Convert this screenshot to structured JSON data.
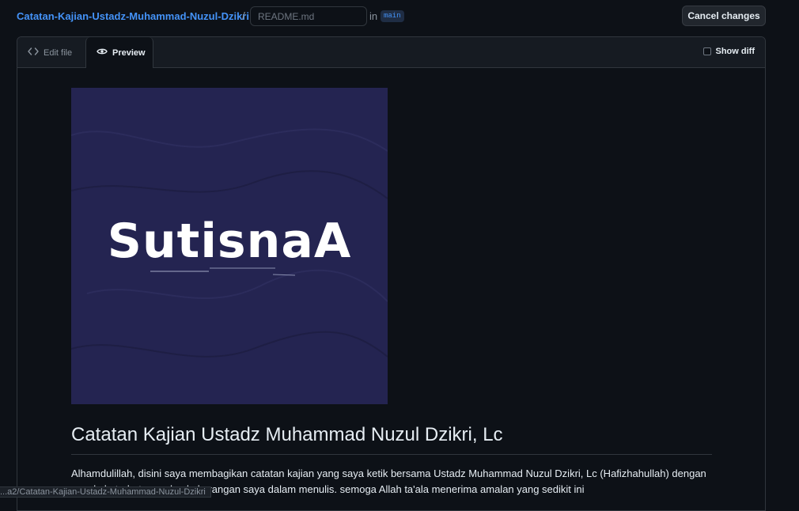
{
  "header": {
    "repo_name": "Catatan-Kajian-Ustadz-Muhammad-Nuzul-Dzikri",
    "separator": "/",
    "filename_placeholder": "README.md",
    "in_label": "in",
    "branch": "main",
    "cancel_label": "Cancel changes"
  },
  "tabs": {
    "edit_label": "Edit file",
    "preview_label": "Preview",
    "show_diff_label": "Show diff"
  },
  "preview": {
    "banner_title": "SutisnaA",
    "heading": "Catatan Kajian Ustadz Muhammad Nuzul Dzikri, Lc",
    "paragraph": "Alhamdulillah, disini saya membagikan catatan kajian yang saya ketik bersama Ustadz Muhammad Nuzul Dzikri, Lc (Hafizhahullah) dengan segala keterbatasan dan kekurangan saya dalam menulis. semoga Allah ta'ala menerima amalan yang sedikit ini"
  },
  "status_bar": {
    "url": "...a2/Catatan-Kajian-Ustadz-Muhammad-Nuzul-Dzikri"
  },
  "colors": {
    "background": "#0d1117",
    "link": "#4493f8",
    "banner": "#242451"
  }
}
